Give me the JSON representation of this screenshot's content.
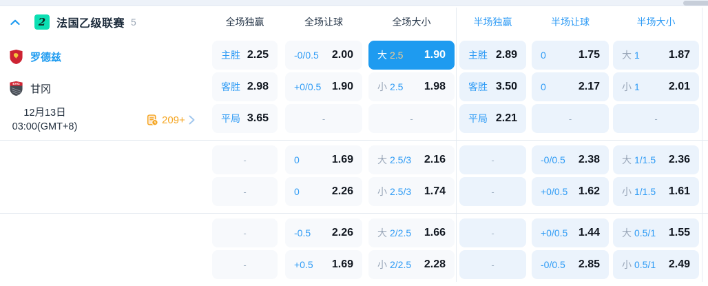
{
  "league_header": {
    "badge": "2",
    "name": "法国乙级联赛",
    "match_count": "5",
    "columns": [
      {
        "label": "全场独赢",
        "scope": "full"
      },
      {
        "label": "全场让球",
        "scope": "full"
      },
      {
        "label": "全场大小",
        "scope": "full"
      },
      {
        "label": "半场独赢",
        "scope": "half"
      },
      {
        "label": "半场让球",
        "scope": "half"
      },
      {
        "label": "半场大小",
        "scope": "half"
      }
    ]
  },
  "match": {
    "home_team": "罗德兹",
    "away_team": "甘冈",
    "date": "12月13日",
    "time": "03:00(GMT+8)",
    "extra_markets": "209+"
  },
  "odds": {
    "groups": [
      {
        "rows": [
          [
            {
              "type": "win",
              "label": "主胜",
              "odds": "2.25"
            },
            {
              "type": "hcp",
              "label": "-0/0.5",
              "odds": "2.00"
            },
            {
              "type": "ou",
              "side": "大",
              "line": "2.5",
              "odds": "1.90",
              "selected": true
            },
            {
              "type": "win",
              "label": "主胜",
              "odds": "2.89"
            },
            {
              "type": "hcp",
              "label": "0",
              "odds": "1.75"
            },
            {
              "type": "ou",
              "side": "大",
              "line": "1",
              "odds": "1.87"
            }
          ],
          [
            {
              "type": "win",
              "label": "客胜",
              "odds": "2.98"
            },
            {
              "type": "hcp",
              "label": "+0/0.5",
              "odds": "1.90"
            },
            {
              "type": "ou",
              "side": "小",
              "line": "2.5",
              "odds": "1.98"
            },
            {
              "type": "win",
              "label": "客胜",
              "odds": "3.50"
            },
            {
              "type": "hcp",
              "label": "0",
              "odds": "2.17"
            },
            {
              "type": "ou",
              "side": "小",
              "line": "1",
              "odds": "2.01"
            }
          ],
          [
            {
              "type": "win",
              "label": "平局",
              "odds": "3.65"
            },
            {
              "type": "dash"
            },
            {
              "type": "dash"
            },
            {
              "type": "win",
              "label": "平局",
              "odds": "2.21"
            },
            {
              "type": "dash"
            },
            {
              "type": "dash"
            }
          ]
        ]
      },
      {
        "rows": [
          [
            {
              "type": "dash"
            },
            {
              "type": "hcp",
              "label": "0",
              "odds": "1.69"
            },
            {
              "type": "ou",
              "side": "大",
              "line": "2.5/3",
              "odds": "2.16"
            },
            {
              "type": "dash"
            },
            {
              "type": "hcp",
              "label": "-0/0.5",
              "odds": "2.38"
            },
            {
              "type": "ou",
              "side": "大",
              "line": "1/1.5",
              "odds": "2.36"
            }
          ],
          [
            {
              "type": "dash"
            },
            {
              "type": "hcp",
              "label": "0",
              "odds": "2.26"
            },
            {
              "type": "ou",
              "side": "小",
              "line": "2.5/3",
              "odds": "1.74"
            },
            {
              "type": "dash"
            },
            {
              "type": "hcp",
              "label": "+0/0.5",
              "odds": "1.62"
            },
            {
              "type": "ou",
              "side": "小",
              "line": "1/1.5",
              "odds": "1.61"
            }
          ]
        ]
      },
      {
        "rows": [
          [
            {
              "type": "dash"
            },
            {
              "type": "hcp",
              "label": "-0.5",
              "odds": "2.26"
            },
            {
              "type": "ou",
              "side": "大",
              "line": "2/2.5",
              "odds": "1.66"
            },
            {
              "type": "dash"
            },
            {
              "type": "hcp",
              "label": "+0/0.5",
              "odds": "1.44"
            },
            {
              "type": "ou",
              "side": "大",
              "line": "0.5/1",
              "odds": "1.55"
            }
          ],
          [
            {
              "type": "dash"
            },
            {
              "type": "hcp",
              "label": "+0.5",
              "odds": "1.69"
            },
            {
              "type": "ou",
              "side": "小",
              "line": "2/2.5",
              "odds": "2.28"
            },
            {
              "type": "dash"
            },
            {
              "type": "hcp",
              "label": "-0/0.5",
              "odds": "2.85"
            },
            {
              "type": "ou",
              "side": "小",
              "line": "0.5/1",
              "odds": "2.49"
            }
          ]
        ]
      }
    ]
  },
  "colors": {
    "accent_blue": "#1e9bf0",
    "selected_cell_bg": "#1e9bf0",
    "selected_line_gold": "#f3cd8e",
    "full_cell_bg": "#f7f9fc",
    "half_cell_bg": "#ebf3fc",
    "league_badge_teal": "#0cdfb3",
    "markets_orange": "#f5a623",
    "odds_text": "#10161f",
    "muted_gray": "#99a6b8"
  }
}
